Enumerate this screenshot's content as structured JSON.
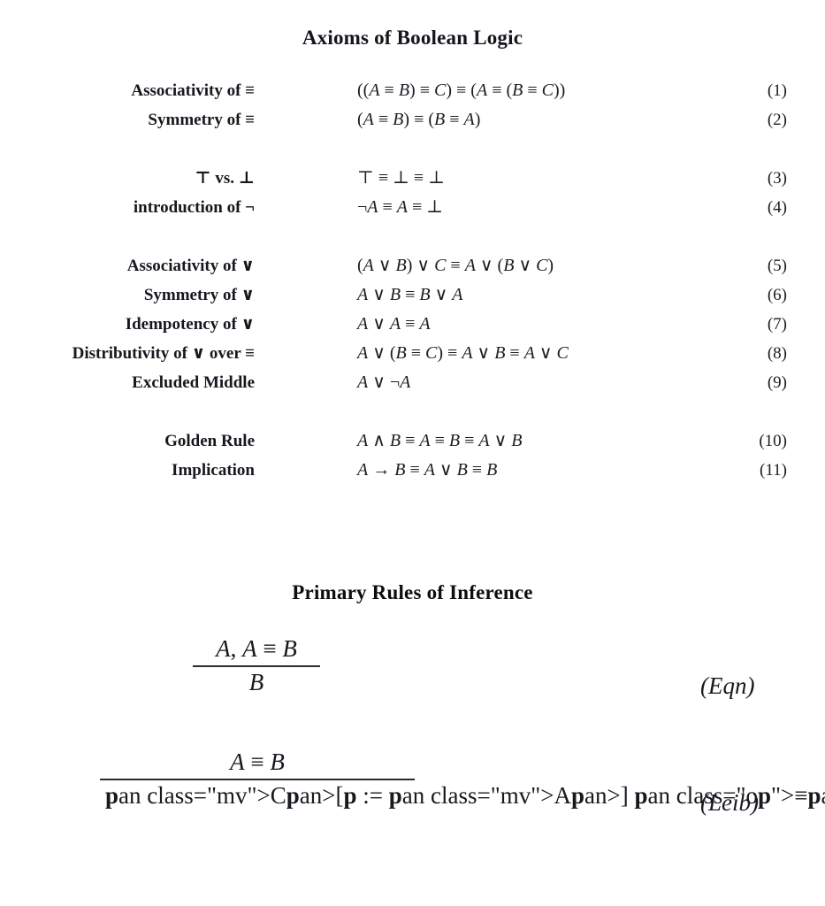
{
  "page": {
    "background": "#ffffff",
    "text_color": "#1a1a1a"
  },
  "headings": {
    "axioms": "Axioms of Boolean Logic",
    "rules": "Primary Rules of Inference"
  },
  "axioms": {
    "groups": [
      {
        "rows": [
          {
            "label": "Associativity of ≡",
            "formula": "((A ≡ B) ≡ C) ≡ (A ≡ (B ≡ C))",
            "number": "(1)"
          },
          {
            "label": "Symmetry of ≡",
            "formula": "(A ≡ B) ≡ (B ≡ A)",
            "number": "(2)"
          }
        ]
      },
      {
        "rows": [
          {
            "label": "⊤ vs. ⊥",
            "formula": "⊤ ≡ ⊥ ≡ ⊥",
            "number": "(3)"
          },
          {
            "label": "introduction of ¬",
            "formula": "¬A ≡ A ≡ ⊥",
            "number": "(4)"
          }
        ]
      },
      {
        "rows": [
          {
            "label": "Associativity of ∨",
            "formula": "(A ∨ B) ∨ C ≡ A ∨ (B ∨ C)",
            "number": "(5)"
          },
          {
            "label": "Symmetry of ∨",
            "formula": "A ∨ B ≡ B ∨ A",
            "number": "(6)"
          },
          {
            "label": "Idempotency of ∨",
            "formula": "A ∨ A ≡ A",
            "number": "(7)"
          },
          {
            "label": "Distributivity of ∨ over ≡",
            "formula": "A ∨ (B ≡ C) ≡ A ∨ B ≡ A ∨ C",
            "number": "(8)"
          },
          {
            "label": "Excluded Middle",
            "formula": "A ∨ ¬A",
            "number": "(9)"
          }
        ]
      },
      {
        "rows": [
          {
            "label": "Golden Rule",
            "formula": "A ∧ B ≡ A ≡ B ≡ A ∨ B",
            "number": "(10)"
          },
          {
            "label": "Implication",
            "formula": "A → B ≡ A ∨ B ≡ B",
            "number": "(11)"
          }
        ]
      }
    ]
  },
  "inference_rules": [
    {
      "id": "eqn",
      "numerator": "A, A ≡ B",
      "denominator": "B",
      "name": "(Eqn)"
    },
    {
      "id": "leib",
      "numerator": "A ≡ B",
      "denominator": "C[p := A] ≡ C[p := B]",
      "name": "(Leib)"
    }
  ]
}
